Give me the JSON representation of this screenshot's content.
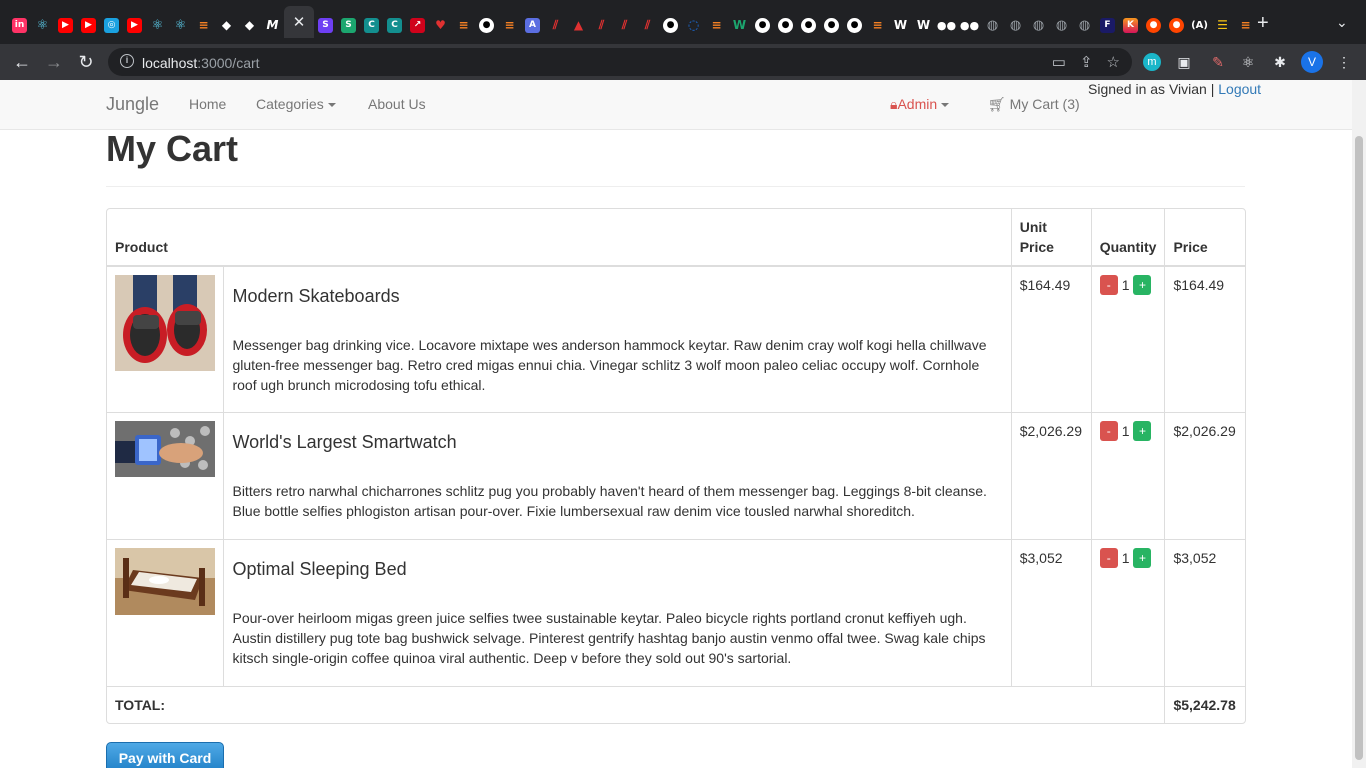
{
  "browser": {
    "url_host": "localhost",
    "url_path": ":3000/cart",
    "avatar_letter": "V",
    "ext_m_letter": "m"
  },
  "navbar": {
    "brand": "Jungle",
    "home": "Home",
    "categories": "Categories",
    "about": "About Us",
    "admin": "Admin",
    "cart": "My Cart (3)",
    "signed_in": "Signed in as Vivian",
    "separator": "|",
    "logout": "Logout"
  },
  "page": {
    "title": "My Cart"
  },
  "table": {
    "headers": {
      "product": "Product",
      "unit_price": "Unit Price",
      "quantity": "Quantity",
      "price": "Price"
    },
    "items": [
      {
        "name": "Modern Skateboards",
        "description": "Messenger bag drinking vice. Locavore mixtape wes anderson hammock keytar. Raw denim cray wolf kogi hella chillwave gluten-free messenger bag. Retro cred migas ennui chia. Vinegar schlitz 3 wolf moon paleo celiac occupy wolf. Cornhole roof ugh brunch microdosing tofu ethical.",
        "unit_price": "$164.49",
        "quantity": "1",
        "price": "$164.49"
      },
      {
        "name": "World's Largest Smartwatch",
        "description": "Bitters retro narwhal chicharrones schlitz pug you probably haven't heard of them messenger bag. Leggings 8-bit cleanse. Blue bottle selfies phlogiston artisan pour-over. Fixie lumbersexual raw denim vice tousled narwhal shoreditch.",
        "unit_price": "$2,026.29",
        "quantity": "1",
        "price": "$2,026.29"
      },
      {
        "name": "Optimal Sleeping Bed",
        "description": "Pour-over heirloom migas green juice selfies twee sustainable keytar. Paleo bicycle rights portland cronut keffiyeh ugh. Austin distillery pug tote bag bushwick selvage. Pinterest gentrify hashtag banjo austin venmo offal twee. Swag kale chips kitsch single-origin coffee quinoa viral authentic. Deep v before they sold out 90's sartorial.",
        "unit_price": "$3,052",
        "quantity": "1",
        "price": "$3,052"
      }
    ],
    "minus": "-",
    "plus": "+",
    "total_label": "TOTAL:",
    "total_value": "$5,242.78"
  },
  "pay_button": "Pay with Card"
}
